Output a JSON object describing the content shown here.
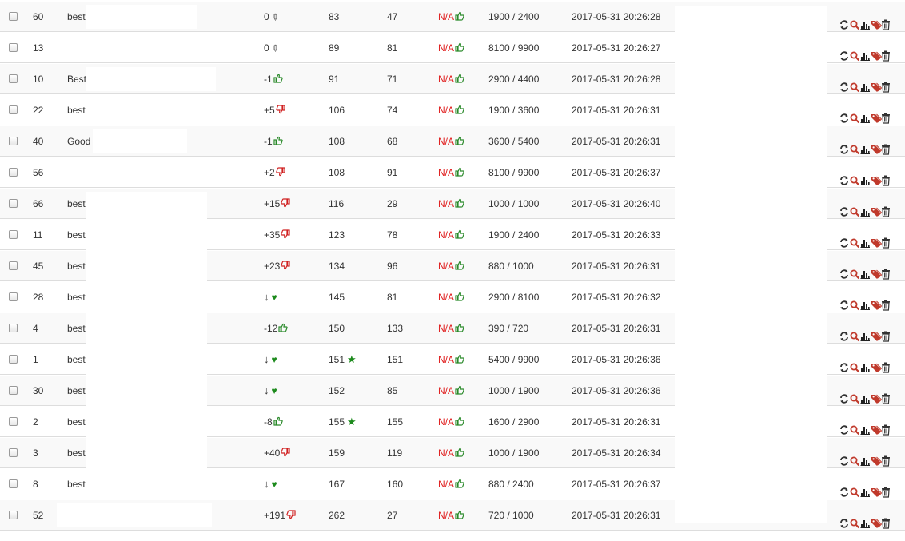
{
  "colors": {
    "up": "#2a8a2a",
    "down": "#d02020",
    "na": "#e02020",
    "refresh": "#333333",
    "search": "#c0392b",
    "chart": "#222222",
    "tag": "#c0392b",
    "trash": "#333333"
  },
  "actions": [
    "refresh-icon",
    "search-icon",
    "bar-chart-icon",
    "tag-icon",
    "trash-icon"
  ],
  "rows": [
    {
      "id": "60",
      "name": "best",
      "change": "0",
      "change_icon": "pin",
      "a": "83",
      "a_star": false,
      "b": "47",
      "na": "N/A",
      "ratio": "1900 / 2400",
      "date": "2017-05-31 20:26:28",
      "redact": [
        108,
        247
      ]
    },
    {
      "id": "13",
      "name": "",
      "change": "0",
      "change_icon": "pin",
      "a": "89",
      "a_star": false,
      "b": "81",
      "na": "N/A",
      "ratio": "8100 / 9900",
      "date": "2017-05-31 20:26:27",
      "redact": [
        77,
        216
      ]
    },
    {
      "id": "10",
      "name": "Best",
      "change": "-1",
      "change_icon": "up",
      "a": "91",
      "a_star": false,
      "b": "71",
      "na": "N/A",
      "ratio": "2900 / 4400",
      "date": "2017-05-31 20:26:28",
      "redact": [
        108,
        270
      ]
    },
    {
      "id": "22",
      "name": "best",
      "change": "+5",
      "change_icon": "down",
      "a": "106",
      "a_star": false,
      "b": "74",
      "na": "N/A",
      "ratio": "1900 / 3600",
      "date": "2017-05-31 20:26:31",
      "redact": [
        108,
        270
      ]
    },
    {
      "id": "40",
      "name": "Good",
      "change": "-1",
      "change_icon": "up",
      "a": "108",
      "a_star": false,
      "b": "68",
      "na": "N/A",
      "ratio": "3600 / 5400",
      "date": "2017-05-31 20:26:31",
      "redact": [
        116,
        234
      ]
    },
    {
      "id": "56",
      "name": "",
      "change": "+2",
      "change_icon": "down",
      "a": "108",
      "a_star": false,
      "b": "91",
      "na": "N/A",
      "ratio": "8100 / 9900",
      "date": "2017-05-31 20:26:37",
      "redact": [
        76,
        216
      ]
    },
    {
      "id": "66",
      "name": "best",
      "change": "+15",
      "change_icon": "down",
      "a": "116",
      "a_star": false,
      "b": "29",
      "na": "N/A",
      "ratio": "1000 / 1000",
      "date": "2017-05-31 20:26:40",
      "redact": [
        108,
        259
      ]
    },
    {
      "id": "11",
      "name": "best",
      "change": "+35",
      "change_icon": "down",
      "a": "123",
      "a_star": false,
      "b": "78",
      "na": "N/A",
      "ratio": "1900 / 2400",
      "date": "2017-05-31 20:26:33",
      "redact": [
        108,
        259
      ]
    },
    {
      "id": "45",
      "name": "best",
      "change": "+23",
      "change_icon": "down",
      "a": "134",
      "a_star": false,
      "b": "96",
      "na": "N/A",
      "ratio": "880 / 1000",
      "date": "2017-05-31 20:26:31",
      "redact": [
        108,
        259
      ]
    },
    {
      "id": "28",
      "name": "best",
      "change": "↓",
      "change_icon": "heart",
      "a": "145",
      "a_star": false,
      "b": "81",
      "na": "N/A",
      "ratio": "2900 / 8100",
      "date": "2017-05-31 20:26:32",
      "redact": [
        108,
        259
      ]
    },
    {
      "id": "4",
      "name": "best",
      "change": "-12",
      "change_icon": "up",
      "a": "150",
      "a_star": false,
      "b": "133",
      "na": "N/A",
      "ratio": "390 / 720",
      "date": "2017-05-31 20:26:31",
      "redact": [
        108,
        259
      ]
    },
    {
      "id": "1",
      "name": "best",
      "change": "↓",
      "change_icon": "heart",
      "a": "151",
      "a_star": true,
      "b": "151",
      "na": "N/A",
      "ratio": "5400 / 9900",
      "date": "2017-05-31 20:26:36",
      "redact": [
        108,
        259
      ]
    },
    {
      "id": "30",
      "name": "best",
      "change": "↓",
      "change_icon": "heart",
      "a": "152",
      "a_star": false,
      "b": "85",
      "na": "N/A",
      "ratio": "1000 / 1900",
      "date": "2017-05-31 20:26:36",
      "redact": [
        108,
        259
      ]
    },
    {
      "id": "2",
      "name": "best",
      "change": "-8",
      "change_icon": "up",
      "a": "155",
      "a_star": true,
      "b": "155",
      "na": "N/A",
      "ratio": "1600 / 2900",
      "date": "2017-05-31 20:26:31",
      "redact": [
        108,
        259
      ]
    },
    {
      "id": "3",
      "name": "best",
      "change": "+40",
      "change_icon": "down",
      "a": "159",
      "a_star": false,
      "b": "119",
      "na": "N/A",
      "ratio": "1000 / 1900",
      "date": "2017-05-31 20:26:34",
      "redact": [
        108,
        259
      ]
    },
    {
      "id": "8",
      "name": "best",
      "change": "↓",
      "change_icon": "heart",
      "a": "167",
      "a_star": false,
      "b": "160",
      "na": "N/A",
      "ratio": "880 / 2400",
      "date": "2017-05-31 20:26:37",
      "redact": [
        108,
        259
      ]
    },
    {
      "id": "52",
      "name": "",
      "change": "+191",
      "change_icon": "down",
      "a": "262",
      "a_star": false,
      "b": "27",
      "na": "N/A",
      "ratio": "720 / 1000",
      "date": "2017-05-31 20:26:31",
      "redact": [
        71,
        265
      ]
    }
  ]
}
